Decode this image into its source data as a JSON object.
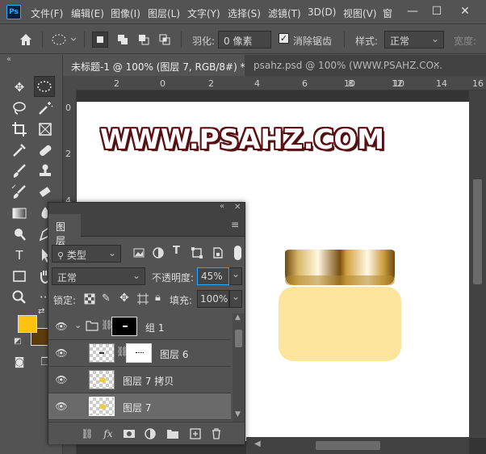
{
  "app": {
    "logo": "Ps"
  },
  "menu": [
    "文件(F)",
    "编辑(E)",
    "图像(I)",
    "图层(L)",
    "文字(Y)",
    "选择(S)",
    "滤镜(T)",
    "3D(D)",
    "视图(V)",
    "窗"
  ],
  "window_controls": {
    "minimize": "—",
    "restore": "☐",
    "close": "✕"
  },
  "options": {
    "feather_label": "羽化:",
    "feather_value": "0 像素",
    "antialias_label": "消除锯齿",
    "antialias_checked": true,
    "style_label": "样式:",
    "style_value": "正常",
    "width_label": "宽度:"
  },
  "tabs": [
    {
      "label": "未标题-1 @ 100% (图层 7, RGB/8#) *",
      "close": "✕"
    },
    {
      "label": "psahz.psd @ 100% (WWW.PSAHZ.CO...",
      "close": "✕"
    }
  ],
  "ruler": {
    "h_ticks": [
      "2",
      "0",
      "2",
      "4",
      "6",
      "8",
      "10",
      "12",
      "14",
      "16"
    ],
    "v_ticks": [
      "0",
      "2",
      "4"
    ]
  },
  "canvas": {
    "watermark": "WWW.PSAHZ.COM"
  },
  "colors": {
    "foreground": "#ffc20e",
    "background": "#5c3c0b",
    "jar_body": "#fde59e",
    "accent_blue": "#31a8ff"
  },
  "layers_panel": {
    "tab": "图层",
    "filter_kind": "类型",
    "blend_mode": "正常",
    "opacity_label": "不透明度:",
    "opacity_value": "45%",
    "lock_label": "锁定:",
    "fill_label": "填充:",
    "fill_value": "100%",
    "layers": [
      {
        "name": "组 1",
        "type": "group",
        "visible": true
      },
      {
        "name": "图层 6",
        "type": "masked",
        "visible": true
      },
      {
        "name": "图层 7 拷贝",
        "type": "pixel",
        "visible": true
      },
      {
        "name": "图层 7",
        "type": "pixel",
        "visible": true,
        "selected": true
      }
    ]
  }
}
